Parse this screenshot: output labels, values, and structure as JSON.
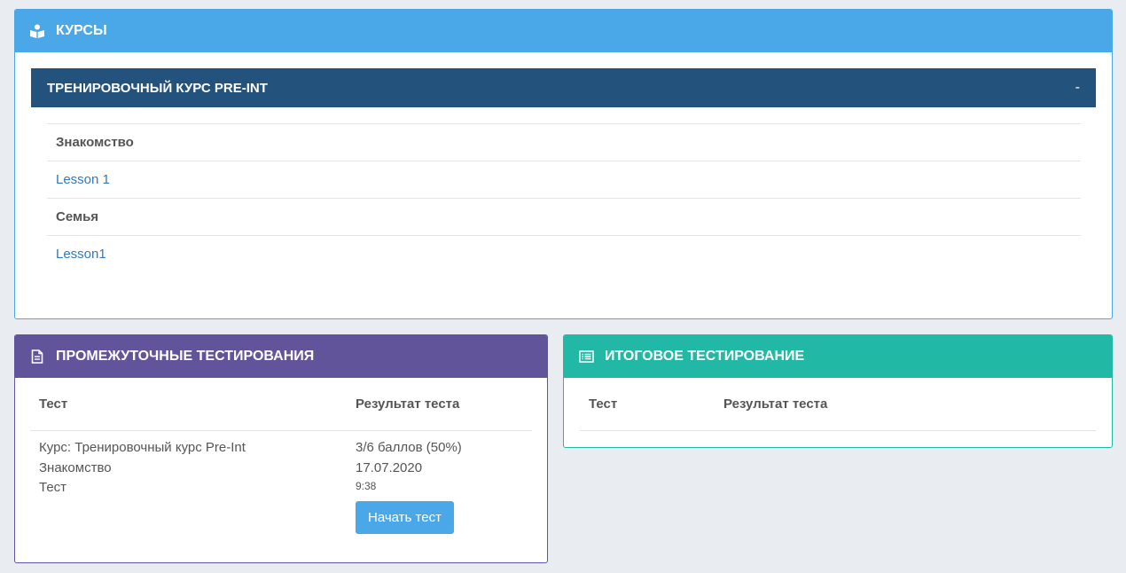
{
  "courses_panel": {
    "title": "КУРСЫ",
    "icon": "reader-icon",
    "header_color": "#4aa8e8",
    "course": {
      "title": "ТРЕНИРОВОЧНЫЙ КУРС PRE-INT",
      "toggle": "-",
      "bar_color": "#23527c",
      "items": [
        {
          "type": "section",
          "label": "Знакомство"
        },
        {
          "type": "link",
          "label": "Lesson 1"
        },
        {
          "type": "section",
          "label": "Семья"
        },
        {
          "type": "link",
          "label": "Lesson1"
        }
      ]
    }
  },
  "mid_tests": {
    "title": "ПРОМЕЖУТОЧНЫЕ ТЕСТИРОВАНИЯ",
    "icon": "document-icon",
    "header_color": "#62549b",
    "columns": [
      "Тест",
      "Результат теста"
    ],
    "row": {
      "test_lines": [
        "Курс: Тренировочный курс Pre-Int",
        "Знакомство",
        "Тест"
      ],
      "score": "3/6 баллов (50%)",
      "date": "17.07.2020",
      "time": "9:38",
      "button": "Начать тест"
    }
  },
  "final_test": {
    "title": "ИТОГОВОЕ ТЕСТИРОВАНИЕ",
    "icon": "list-icon",
    "header_color": "#22b8a6",
    "columns": [
      "Тест",
      "Результат теста"
    ]
  }
}
